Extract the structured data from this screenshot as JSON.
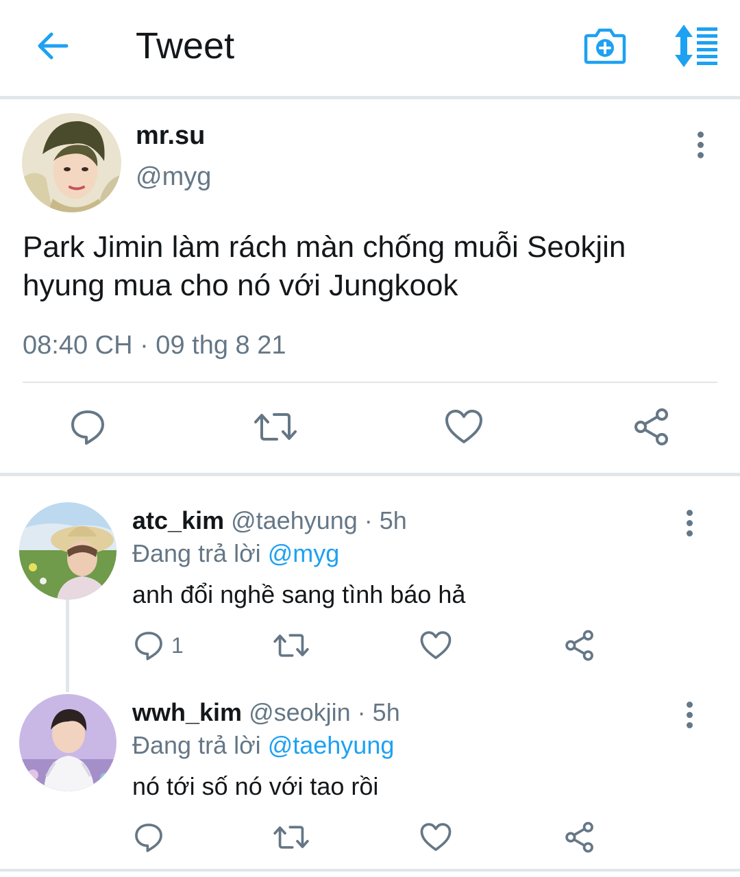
{
  "header": {
    "title": "Tweet",
    "back_icon": "arrow-left-icon",
    "camera_icon": "camera-add-icon",
    "sort_icon": "sort-icon",
    "accent": "#1da1f2"
  },
  "main_tweet": {
    "display_name": "mr.su",
    "handle": "@myg",
    "text": "Park Jimin làm rách màn chống muỗi Seokjin hyung mua cho nó với Jungkook",
    "timestamp": "08:40 CH · 09 thg 8 21"
  },
  "replies": [
    {
      "display_name": "atc_kim",
      "handle": "@taehyung · 5h",
      "replying_prefix": "Đang trả lời ",
      "replying_to": "@myg",
      "text": "anh đổi nghề sang tình báo hả",
      "reply_count": "1"
    },
    {
      "display_name": "wwh_kim",
      "handle": "@seokjin · 5h",
      "replying_prefix": "Đang trả lời ",
      "replying_to": "@taehyung",
      "text": "nó tới số nó với tao rồi",
      "reply_count": ""
    }
  ],
  "colors": {
    "text": "#14171a",
    "secondary": "#657786",
    "mention": "#1da1f2",
    "divider": "#e1e6ea"
  }
}
